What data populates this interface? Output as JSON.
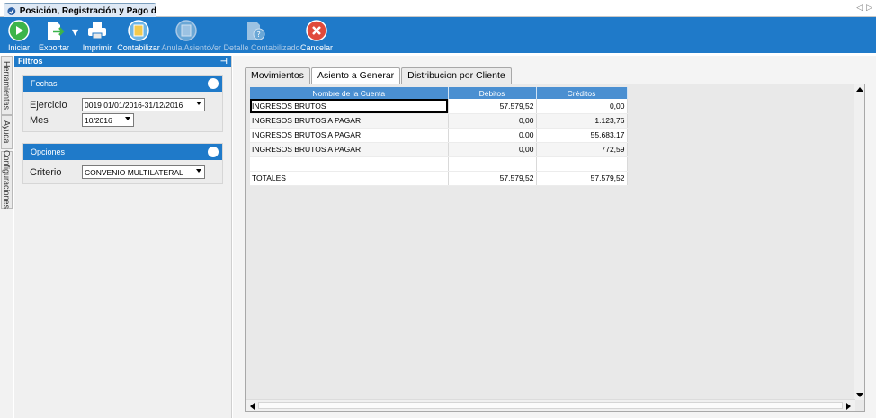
{
  "window": {
    "tab_title": "Posición, Registración y Pago de I..."
  },
  "toolbar": {
    "buttons": [
      {
        "label": "Iniciar",
        "icon": "play-icon",
        "enabled": true
      },
      {
        "label": "Exportar",
        "icon": "export-icon",
        "enabled": true
      },
      {
        "label": "Imprimir",
        "icon": "printer-icon",
        "enabled": true
      },
      {
        "label": "Contabilizar",
        "icon": "ledger-icon",
        "enabled": true
      },
      {
        "label": "Anula Asiento",
        "icon": "cancel-entry-icon",
        "enabled": false
      },
      {
        "label": "Ver Detalle Contabilizado",
        "icon": "detail-icon",
        "enabled": false
      },
      {
        "label": "Cancelar",
        "icon": "cancel-icon",
        "enabled": true
      }
    ]
  },
  "side_tabs": [
    "Herramientas",
    "Ayuda",
    "Configuraciones"
  ],
  "filters": {
    "title": "Filtros",
    "fechas": {
      "title": "Fechas",
      "ejercicio_label": "Ejercicio",
      "ejercicio_value": "0019 01/01/2016-31/12/2016",
      "mes_label": "Mes",
      "mes_value": "10/2016"
    },
    "opciones": {
      "title": "Opciones",
      "criterio_label": "Criterio",
      "criterio_value": "CONVENIO MULTILATERAL"
    }
  },
  "main": {
    "tabs": [
      "Movimientos",
      "Asiento a Generar",
      "Distribucion por Cliente"
    ],
    "active_tab": 1,
    "grid": {
      "columns": [
        "Nombre de la Cuenta",
        "Débitos",
        "Créditos"
      ],
      "rows": [
        {
          "cuenta": "INGRESOS BRUTOS",
          "debitos": "57.579,52",
          "creditos": "0,00"
        },
        {
          "cuenta": "INGRESOS BRUTOS A PAGAR",
          "debitos": "0,00",
          "creditos": "1.123,76"
        },
        {
          "cuenta": "INGRESOS BRUTOS A PAGAR",
          "debitos": "0,00",
          "creditos": "55.683,17"
        },
        {
          "cuenta": "INGRESOS BRUTOS A PAGAR",
          "debitos": "0,00",
          "creditos": "772,59"
        },
        {
          "cuenta": "",
          "debitos": "",
          "creditos": ""
        },
        {
          "cuenta": "TOTALES",
          "debitos": "57.579,52",
          "creditos": "57.579,52"
        }
      ]
    }
  },
  "colors": {
    "accent": "#1f7ac9",
    "grid_header": "#4a8fd1"
  }
}
